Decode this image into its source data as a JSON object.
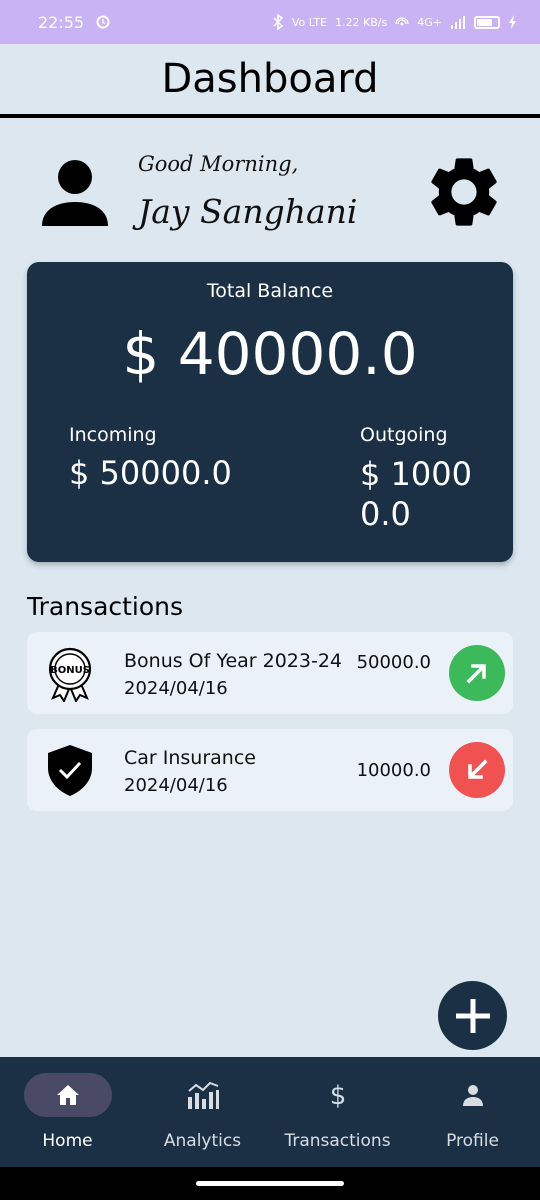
{
  "status_bar": {
    "time": "22:55",
    "network_text": "Vo LTE",
    "speed_text": "1.22 KB/s",
    "signal_text": "4G+",
    "color": "#c9b3f5"
  },
  "app_bar": {
    "title": "Dashboard"
  },
  "greeting": {
    "salutation": "Good Morning,",
    "name": "Jay Sanghani"
  },
  "balance": {
    "label": "Total Balance",
    "value": "$ 40000.0",
    "incoming_label": "Incoming",
    "incoming_value": "$ 50000.0",
    "outgoing_label": "Outgoing",
    "outgoing_value": "$ 10000.0",
    "card_color": "#1c3045"
  },
  "transactions": {
    "heading": "Transactions",
    "items": [
      {
        "title": "Bonus Of Year 2023-24",
        "date": "2024/04/16",
        "amount": "50000.0",
        "icon": "bonus-badge-icon",
        "direction": "incoming",
        "arrow_color": "#3cb95a"
      },
      {
        "title": "Car Insurance",
        "date": "2024/04/16",
        "amount": "10000.0",
        "icon": "shield-check-icon",
        "direction": "outgoing",
        "arrow_color": "#f05252"
      }
    ]
  },
  "fab": {
    "icon": "plus-icon"
  },
  "bottom_nav": {
    "items": [
      {
        "label": "Home",
        "icon": "home-icon",
        "active": true
      },
      {
        "label": "Analytics",
        "icon": "analytics-icon",
        "active": false
      },
      {
        "label": "Transactions",
        "icon": "dollar-icon",
        "active": false
      },
      {
        "label": "Profile",
        "icon": "person-icon",
        "active": false
      }
    ]
  }
}
